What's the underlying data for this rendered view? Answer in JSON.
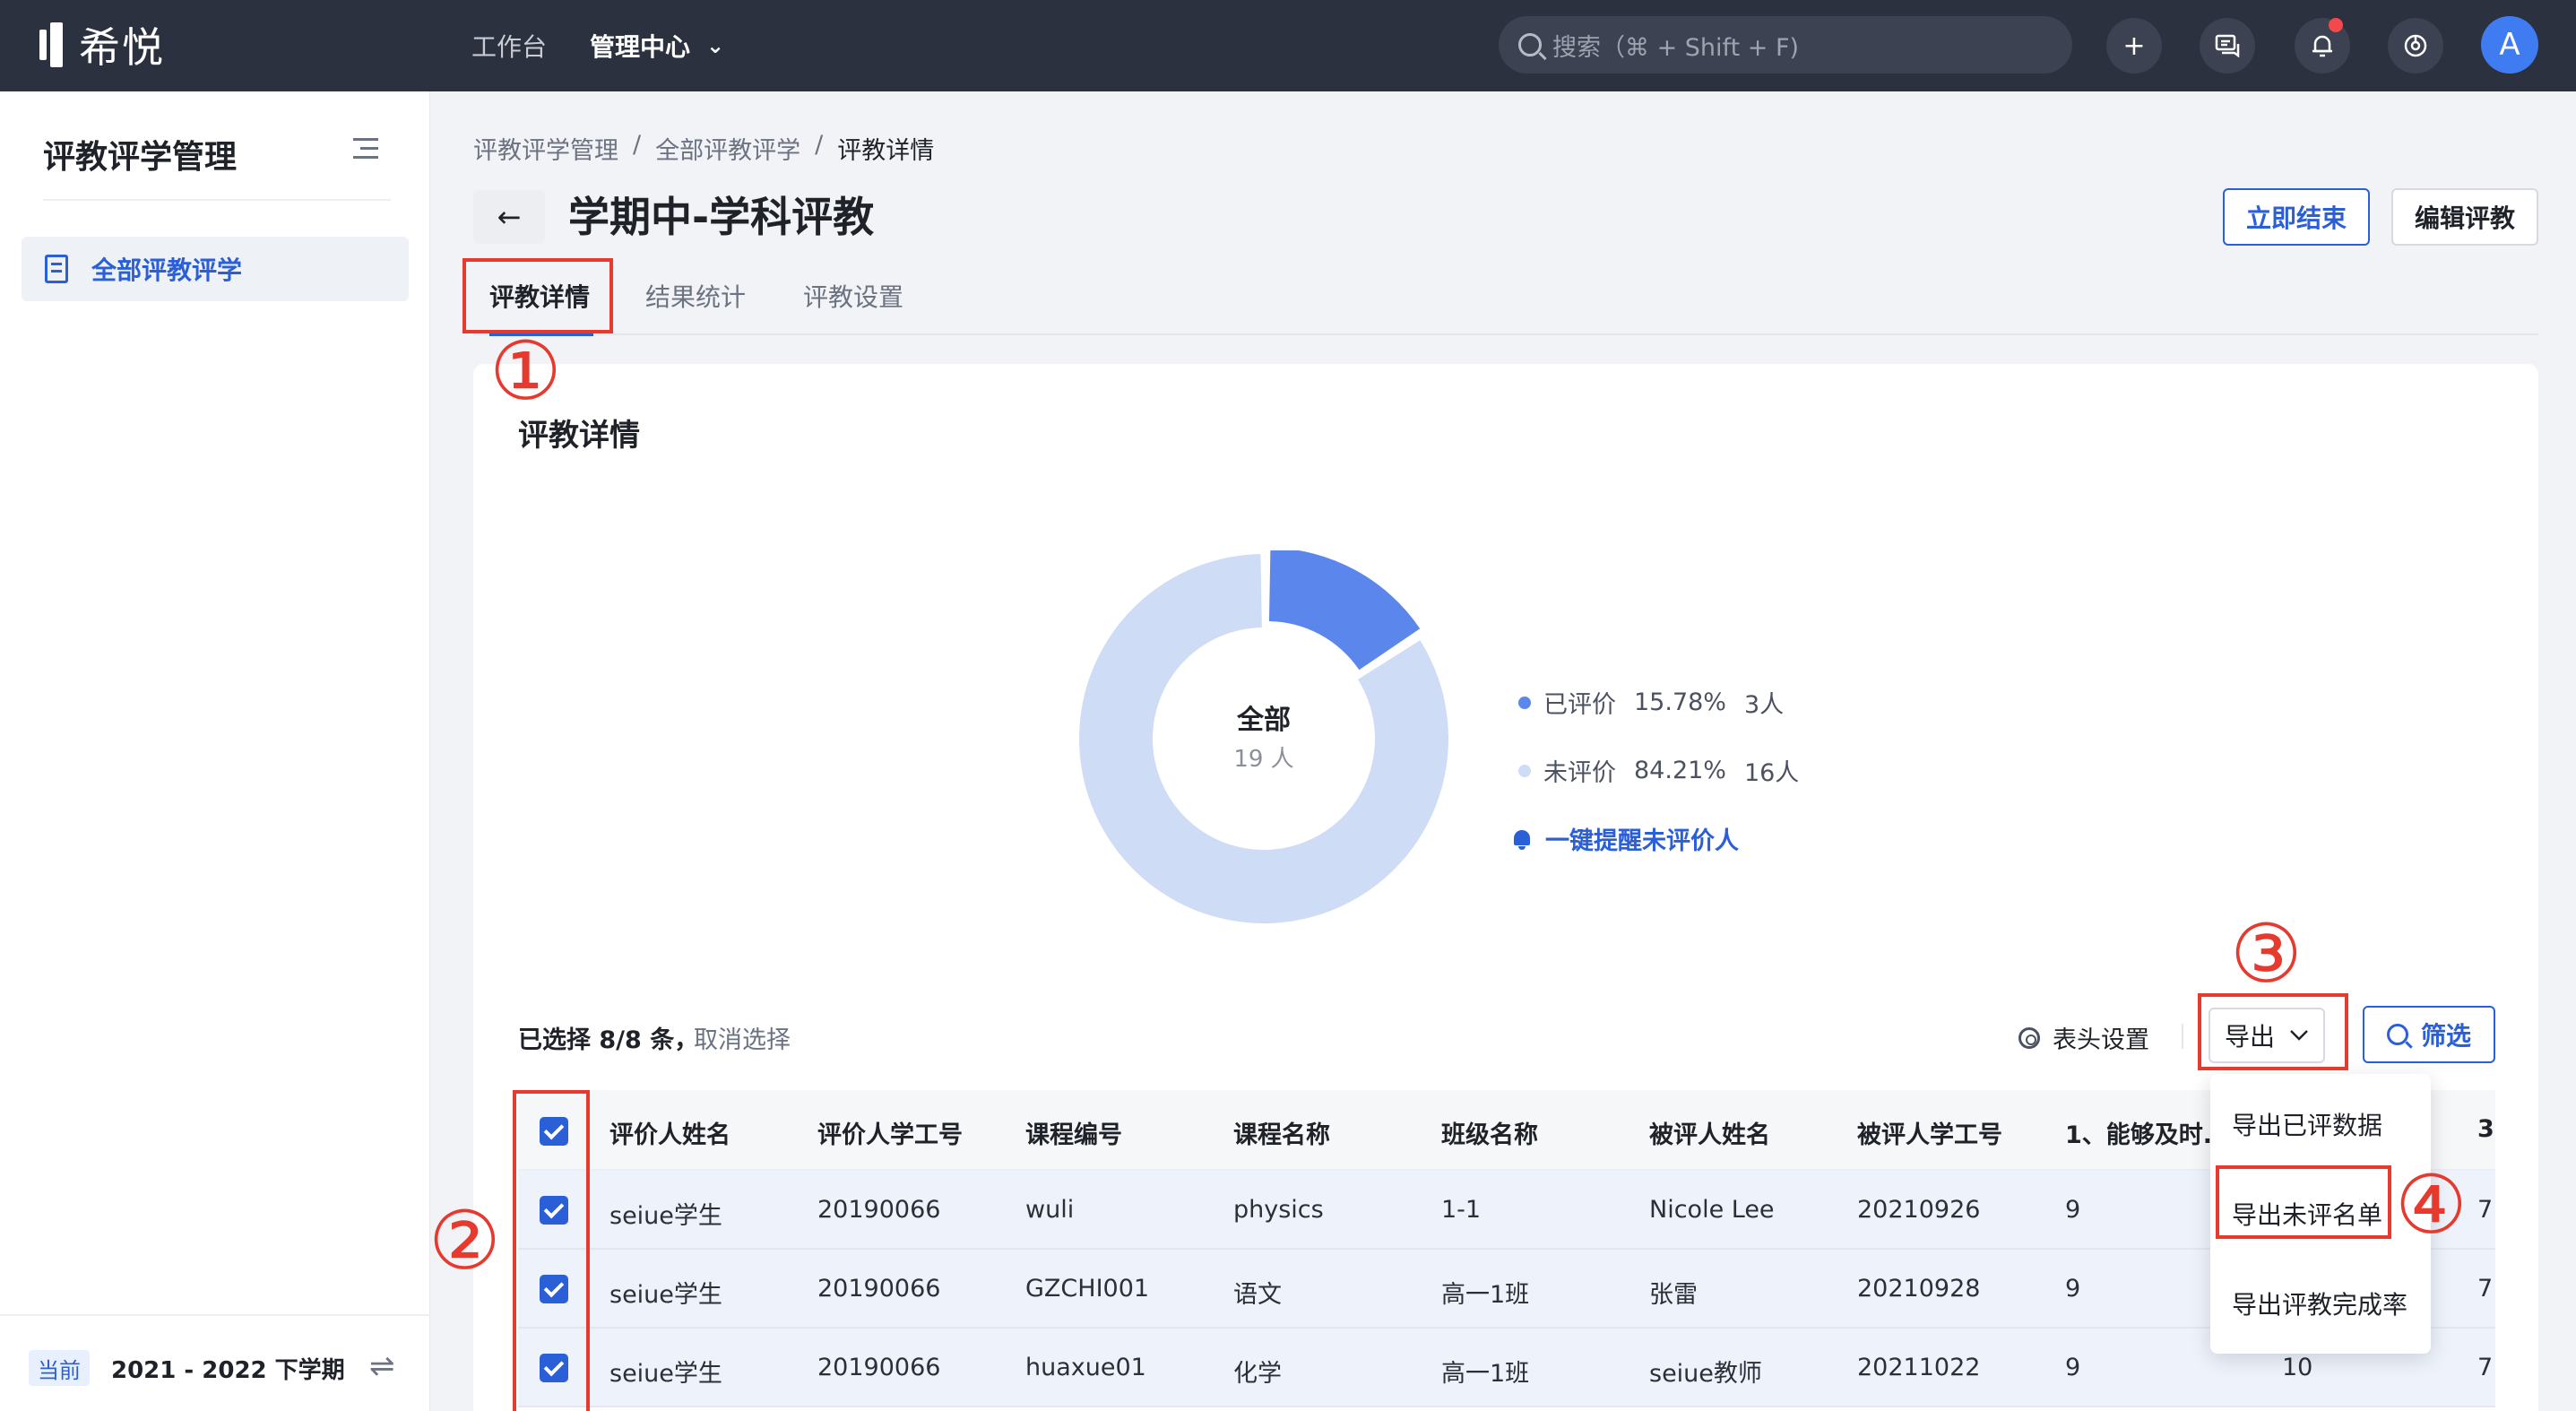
{
  "topbar": {
    "logo_text": "希悦",
    "nav": [
      {
        "label": "工作台"
      },
      {
        "label": "管理中心"
      }
    ],
    "search_placeholder": "搜索（⌘ + Shift + F)",
    "avatar_letter": "A",
    "icons": [
      "plus-icon",
      "message-icon",
      "bell-icon",
      "support-icon"
    ]
  },
  "sidebar": {
    "title": "评教评学管理",
    "items": [
      {
        "label": "全部评教评学"
      }
    ],
    "semester_tag": "当前",
    "semester": "2021 - 2022 下学期"
  },
  "breadcrumb": [
    "评教评学管理",
    "/",
    "全部评教评学",
    "/",
    "评教详情"
  ],
  "page": {
    "title": "学期中-学科评教",
    "end_now": "立即结束",
    "edit": "编辑评教"
  },
  "tabs": [
    {
      "label": "评教详情",
      "active": true
    },
    {
      "label": "结果统计"
    },
    {
      "label": "评教设置"
    }
  ],
  "annotations": [
    "①",
    "②",
    "③",
    "④"
  ],
  "card": {
    "title": "评教详情",
    "donut": {
      "center_label": "全部",
      "center_sub": "19 人",
      "segments": [
        {
          "label": "已评价",
          "percent": "15.78%",
          "count": "3人",
          "value": 15.78,
          "color": "#5b86ec"
        },
        {
          "label": "未评价",
          "percent": "84.21%",
          "count": "16人",
          "value": 84.21,
          "color": "#cfdcf6"
        }
      ]
    },
    "remind": "一键提醒未评价人",
    "selection": "已选择 8/8 条，",
    "cancel_selection": "取消选择",
    "header_setting": "表头设置",
    "export": "导出",
    "filter": "筛选"
  },
  "table": {
    "columns": [
      "评价人姓名",
      "评价人学工号",
      "课程编号",
      "课程名称",
      "班级名称",
      "被评人姓名",
      "被评人学工号",
      "1、能够及时...",
      "3"
    ],
    "rows": [
      [
        "seiue学生",
        "20190066",
        "wuli",
        "physics",
        "1-1",
        "Nicole Lee",
        "20210926",
        "9",
        "",
        "7"
      ],
      [
        "seiue学生",
        "20190066",
        "GZCHI001",
        "语文",
        "高一1班",
        "张雷",
        "20210928",
        "9",
        "",
        "7"
      ],
      [
        "seiue学生",
        "20190066",
        "huaxue01",
        "化学",
        "高一1班",
        "seiue教师",
        "20211022",
        "9",
        "10",
        "7"
      ]
    ]
  },
  "export_menu": [
    "导出已评数据",
    "导出未评名单",
    "导出评教完成率"
  ]
}
